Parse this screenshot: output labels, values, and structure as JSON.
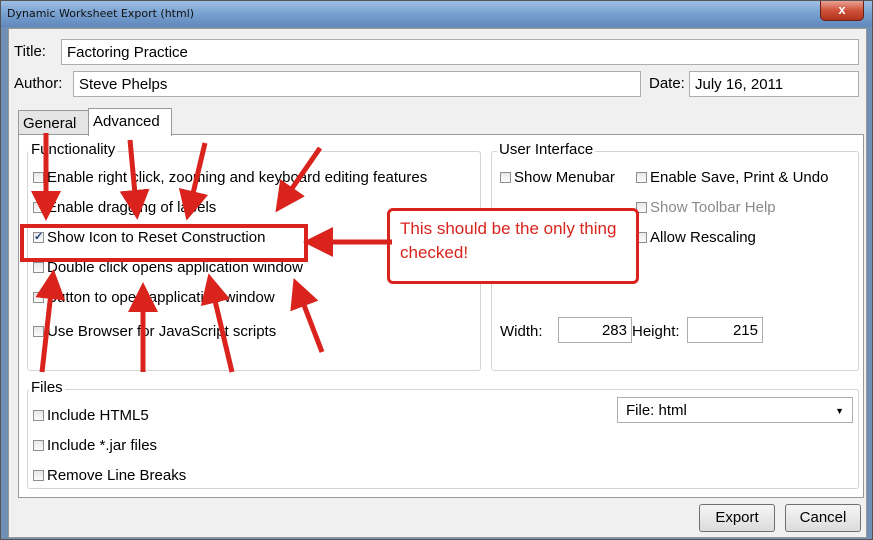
{
  "window": {
    "title": "Dynamic Worksheet Export (html)",
    "close_label": "x"
  },
  "form": {
    "title_label": "Title:",
    "title_value": "Factoring Practice",
    "author_label": "Author:",
    "author_value": "Steve Phelps",
    "date_label": "Date:",
    "date_value": "July 16, 2011"
  },
  "tabs": [
    {
      "label": "General",
      "active": false
    },
    {
      "label": "Advanced",
      "active": true
    }
  ],
  "functionality": {
    "title": "Functionality",
    "items": [
      {
        "label": "Enable right click, zooming and keyboard editing features",
        "checked": false
      },
      {
        "label": "Enable dragging of labels",
        "checked": false
      },
      {
        "label": "Show Icon to Reset Construction",
        "checked": true
      },
      {
        "label": "Double click opens application window",
        "checked": false
      },
      {
        "label": "Button to open application window",
        "checked": false
      },
      {
        "label": "Use Browser for JavaScript scripts",
        "checked": false
      }
    ]
  },
  "user_interface": {
    "title": "User Interface",
    "show_menubar": "Show Menubar",
    "enable_save": "Enable Save, Print & Undo",
    "show_toolbar_help": "Show Toolbar Help",
    "allow_rescaling": "Allow Rescaling",
    "width_label": "Width:",
    "width_value": "283",
    "height_label": "Height:",
    "height_value": "215"
  },
  "files": {
    "title": "Files",
    "items": [
      {
        "label": "Include HTML5",
        "checked": false
      },
      {
        "label": "Include *.jar files",
        "checked": false
      },
      {
        "label": "Remove Line Breaks",
        "checked": false
      }
    ],
    "file_select": "File: html"
  },
  "buttons": {
    "export": "Export",
    "cancel": "Cancel"
  },
  "annotation": {
    "callout_text": "This should be the only thing checked!",
    "color": "#d9231c"
  }
}
